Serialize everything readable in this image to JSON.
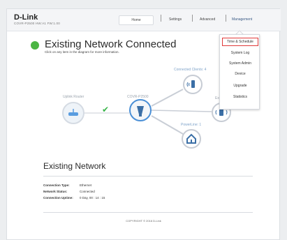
{
  "header": {
    "logo": "D-Link",
    "subtitle": "COVR-P2500  HW:A1  FW:1.00",
    "nav": {
      "home": "Home",
      "settings": "Settings",
      "advanced": "Advanced",
      "management": "Management"
    }
  },
  "main": {
    "title": "Existing Network Connected",
    "hint": "Click on any item in the diagram for more information."
  },
  "diagram": {
    "uplink_router": "Uplink Router",
    "covr": "COVR-P2500",
    "connected_clients": "Connected Clients: 4",
    "extender": "Exte",
    "powerline": "PowerLine: 1"
  },
  "details": {
    "title": "Existing Network",
    "connection_type_label": "Connection Type:",
    "connection_type_value": "Ethernet",
    "network_status_label": "Network Status:",
    "network_status_value": "Connected",
    "uptime_label": "Connection Uptime:",
    "uptime_value": "0 Day, 00 : 14 : 15"
  },
  "footer": {
    "copyright": "COPYRIGHT © 2016 D-Link"
  },
  "menu": {
    "items": [
      "Time & Schedule",
      "System Log",
      "System Admin",
      "Device",
      "Upgrade",
      "Statistics"
    ]
  }
}
